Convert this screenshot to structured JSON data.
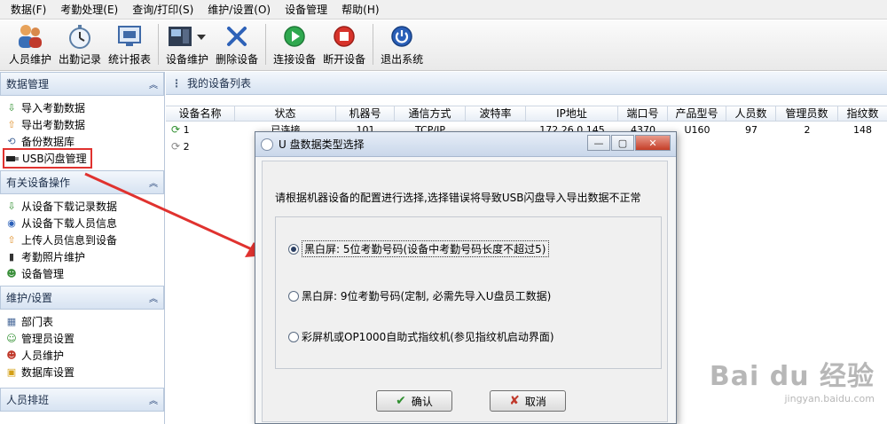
{
  "menu": [
    "数据(F)",
    "考勤处理(E)",
    "查询/打印(S)",
    "维护/设置(O)",
    "设备管理",
    "帮助(H)"
  ],
  "toolbar": {
    "group1": [
      "人员维护",
      "出勤记录",
      "统计报表"
    ],
    "group2": [
      "设备维护",
      "删除设备"
    ],
    "group3": [
      "连接设备",
      "断开设备"
    ],
    "group4": [
      "退出系统"
    ]
  },
  "sidebar": {
    "panels": [
      {
        "title": "数据管理",
        "items": [
          "导入考勤数据",
          "导出考勤数据",
          "备份数据库",
          "USB闪盘管理"
        ]
      },
      {
        "title": "有关设备操作",
        "items": [
          "从设备下载记录数据",
          "从设备下载人员信息",
          "上传人员信息到设备",
          "考勤照片维护",
          "设备管理"
        ]
      },
      {
        "title": "维护/设置",
        "items": [
          "部门表",
          "管理员设置",
          "人员维护",
          "数据库设置"
        ]
      },
      {
        "title": "人员排班",
        "items": []
      }
    ]
  },
  "main": {
    "title": "我的设备列表",
    "columns": [
      "设备名称",
      "状态",
      "机器号",
      "通信方式",
      "波特率",
      "IP地址",
      "端口号",
      "产品型号",
      "人员数",
      "管理员数",
      "指纹数"
    ],
    "rows": [
      [
        "1",
        "已连接",
        "101",
        "TCP/IP",
        "",
        "172.26.0.145",
        "4370",
        "U160",
        "97",
        "2",
        "148"
      ],
      [
        "2",
        "",
        "",
        "",
        "",
        "",
        "",
        "",
        "",
        "",
        ""
      ]
    ]
  },
  "dialog": {
    "title": "U 盘数据类型选择",
    "prompt": "请根据机器设备的配置进行选择,选择错误将导致USB闪盘导入导出数据不正常",
    "options": [
      "黑白屏: 5位考勤号码(设备中考勤号码长度不超过5)",
      "黑白屏: 9位考勤号码(定制, 必需先导入U盘员工数据)",
      "彩屏机或OP1000自助式指纹机(参见指纹机启动界面)"
    ],
    "selected": 0,
    "ok_label": "确认",
    "cancel_label": "取消"
  },
  "watermark": {
    "main": "Bai du 经验",
    "sub": "jingyan.baidu.com"
  },
  "colors": {
    "highlight": "#e0322f",
    "panel_header": "#d7e3f2"
  }
}
